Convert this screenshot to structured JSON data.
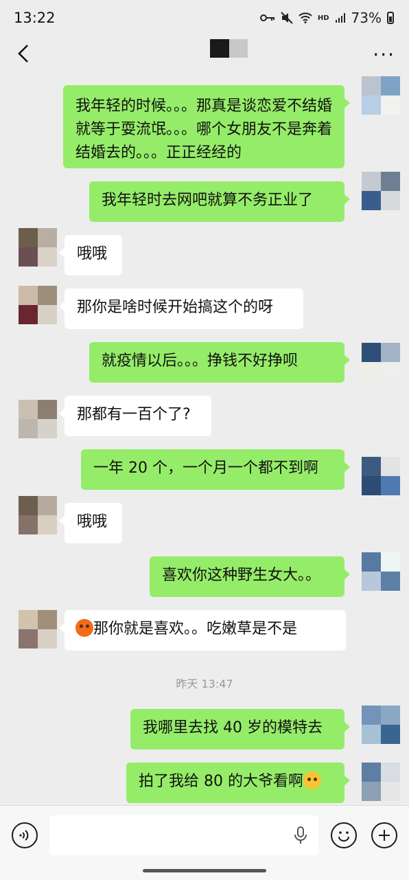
{
  "status_bar": {
    "time": "13:22",
    "hd": "HD",
    "battery": "73%"
  },
  "chat": {
    "messages": [
      {
        "side": "me",
        "text": "我年轻的时候。。。那真是谈恋爱不结婚就等于耍流氓。。。哪个女朋友不是奔着结婚去的。。。正正经经的"
      },
      {
        "side": "me",
        "text": "我年轻时去网吧就算不务正业了"
      },
      {
        "side": "them",
        "text": "哦哦"
      },
      {
        "side": "them",
        "text": "那你是啥时候开始搞这个的呀"
      },
      {
        "side": "me",
        "text": "就疫情以后。。。挣钱不好挣呗"
      },
      {
        "side": "them",
        "text": "那都有一百个了?"
      },
      {
        "side": "me",
        "text": "一年 20 个，一个月一个都不到啊"
      },
      {
        "side": "them",
        "text": "哦哦"
      },
      {
        "side": "me",
        "text": "喜欢你这种野生女大。。"
      },
      {
        "side": "them",
        "text": "那你就是喜欢。。吃嫩草是不是",
        "emoji_before": "angry-face-emoji"
      },
      {
        "side": "me",
        "text": "我哪里去找 40 岁的模特去"
      },
      {
        "side": "me",
        "text": "拍了我给 80 的大爷看啊",
        "emoji_after": "tears-of-joy-emoji"
      }
    ],
    "timestamp": "昨天 13:47"
  },
  "colors": {
    "my_bubble": "#95ec69",
    "their_bubble": "#ffffff",
    "background": "#ededed"
  }
}
